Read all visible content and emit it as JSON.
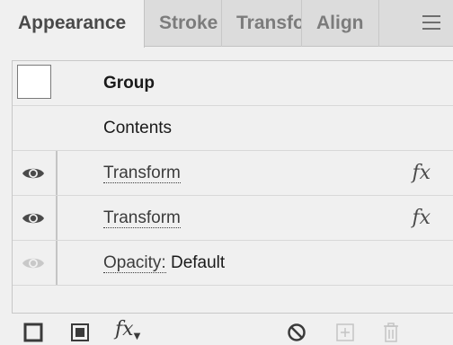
{
  "tabs": [
    {
      "label": "Appearance",
      "active": true
    },
    {
      "label": "Stroke",
      "active": false
    },
    {
      "label": "Transform",
      "active": false
    },
    {
      "label": "Align",
      "active": false
    }
  ],
  "appearance": {
    "object_type": "Group",
    "contents_label": "Contents",
    "rows": [
      {
        "label": "Transform",
        "visible": true,
        "fx": "fx"
      },
      {
        "label": "Transform",
        "visible": true,
        "fx": "fx"
      },
      {
        "label": "Opacity:",
        "value": "Default",
        "visible": true,
        "dimmed": true
      }
    ]
  },
  "toolbar": {
    "fx_label": "fx",
    "icons": [
      "add-new-stroke-icon",
      "add-new-fill-icon",
      "add-new-effect-icon",
      "clear-appearance-icon",
      "duplicate-item-icon",
      "delete-item-icon"
    ]
  },
  "colors": {
    "panel_bg": "#f0f0f0",
    "tabbar_bg": "#dcdcdc",
    "text": "#1a1a1a",
    "icon": "#4a4a4a",
    "icon_disabled": "#c4c4c4"
  }
}
